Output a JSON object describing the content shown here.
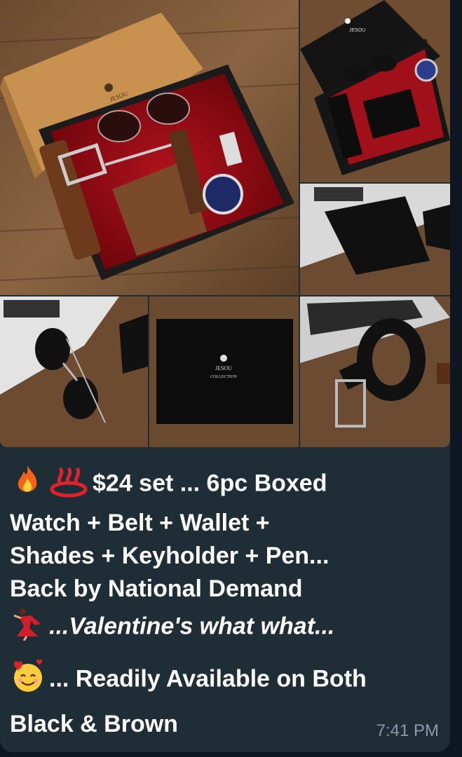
{
  "product": {
    "brand_logo_text": "JESOU",
    "brand_collection_text": "COLLECTION"
  },
  "message": {
    "line1": "$24 set ... 6pc Boxed",
    "line2": "Watch + Belt + Wallet +",
    "line3": "Shades + Keyholder + Pen...",
    "line4": "Back by National Demand",
    "line5": "...Valentine's what what...",
    "line6": "... Readily Available on Both",
    "line7": "Black & Brown",
    "timestamp": "7:41 PM"
  },
  "icons": [
    "fire-icon",
    "hot-springs-icon",
    "dancer-icon",
    "smiling-face-with-hearts-icon"
  ],
  "colors": {
    "bubble": "#1f2d37",
    "background": "#0e1621",
    "timestamp": "#8a9aa6"
  }
}
